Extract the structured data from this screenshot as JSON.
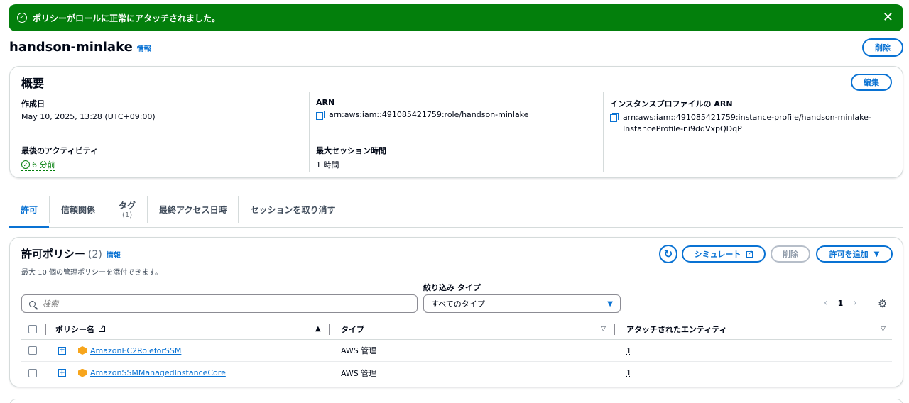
{
  "flash": {
    "message": "ポリシーがロールに正常にアタッチされました。",
    "type": "success",
    "color": "#037f0c"
  },
  "header": {
    "title": "handson-minlake",
    "info": "情報",
    "delete_label": "削除"
  },
  "summary": {
    "title": "概要",
    "edit_label": "編集",
    "created_label": "作成日",
    "created_value": "May 10, 2025, 13:28 (UTC+09:00)",
    "last_activity_label": "最後のアクティビティ",
    "last_activity_value": "6 分前",
    "arn_label": "ARN",
    "arn_value": "arn:aws:iam::491085421759:role/handson-minlake",
    "max_session_label": "最大セッション時間",
    "max_session_value": "1 時間",
    "instance_profile_label": "インスタンスプロファイルの ARN",
    "instance_profile_line1": "arn:aws:iam::491085421759:instance-profile/handson-minlake-",
    "instance_profile_line2": "InstanceProfile-ni9dqVxpQDqP"
  },
  "tabs": [
    {
      "label": "許可",
      "active": true
    },
    {
      "label": "信頼関係"
    },
    {
      "label": "タグ",
      "count": "(1)"
    },
    {
      "label": "最終アクセス日時"
    },
    {
      "label": "セッションを取り消す"
    }
  ],
  "policies": {
    "title": "許可ポリシー",
    "count": "(2)",
    "info": "情報",
    "description": "最大 10 個の管理ポリシーを添付できます。",
    "simulate_label": "シミュレート",
    "delete_label": "削除",
    "add_label": "許可を追加",
    "search_placeholder": "検索",
    "filter_label": "絞り込み タイプ",
    "filter_value": "すべてのタイプ",
    "page": "1",
    "columns": {
      "name": "ポリシー名",
      "type": "タイプ",
      "entities": "アタッチされたエンティティ"
    },
    "rows": [
      {
        "name": "AmazonEC2RoleforSSM",
        "type": "AWS 管理",
        "entities": "1"
      },
      {
        "name": "AmazonSSMManagedInstanceCore",
        "type": "AWS 管理",
        "entities": "1"
      }
    ]
  },
  "colors": {
    "accent": "#0972d3",
    "success": "#037f0c",
    "aws_orange": "#f7a51c"
  }
}
